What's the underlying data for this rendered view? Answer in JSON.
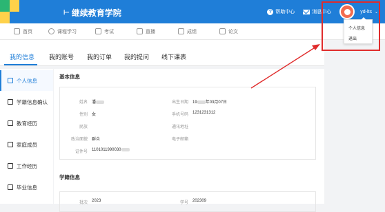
{
  "topbar": {
    "brand": "继续教育学院",
    "help": "帮助中心",
    "messages": "消息中心",
    "user": "yd-lts"
  },
  "nav": [
    "首页",
    "课程学习",
    "考试",
    "直播",
    "成绩",
    "论文"
  ],
  "tabs": [
    "我的信息",
    "我的账号",
    "我的订单",
    "我的提问",
    "线下课表"
  ],
  "sidebar": [
    "个人信息",
    "学籍信息确认",
    "教育经历",
    "家庭成员",
    "工作经历",
    "毕业信息"
  ],
  "basic_info": {
    "title": "基本信息",
    "name_label": "姓名",
    "name_value": "潘",
    "gender_label": "性别",
    "gender_value": "女",
    "ethnicity_label": "民族",
    "ethnicity_value": "",
    "politics_label": "政治面貌",
    "politics_value": "群众",
    "id_label": "证件号",
    "id_value": "1101011990030",
    "birth_label": "出生日期",
    "birth_value": "19",
    "birth_value_tail": "年03月07日",
    "phone_label": "手机号码",
    "phone_value": "1231231312",
    "address_label": "通讯地址",
    "address_value": "",
    "email_label": "电子邮箱",
    "email_value": ""
  },
  "enroll_info": {
    "title": "学籍信息",
    "batch_label": "批次",
    "batch_value": "2023",
    "student_no_label": "学号",
    "student_no_value": "202309"
  },
  "dropdown": [
    "个人信息",
    "退出"
  ],
  "colors": {
    "primary": "#1f7ed8",
    "highlight": "#e02c2c"
  }
}
